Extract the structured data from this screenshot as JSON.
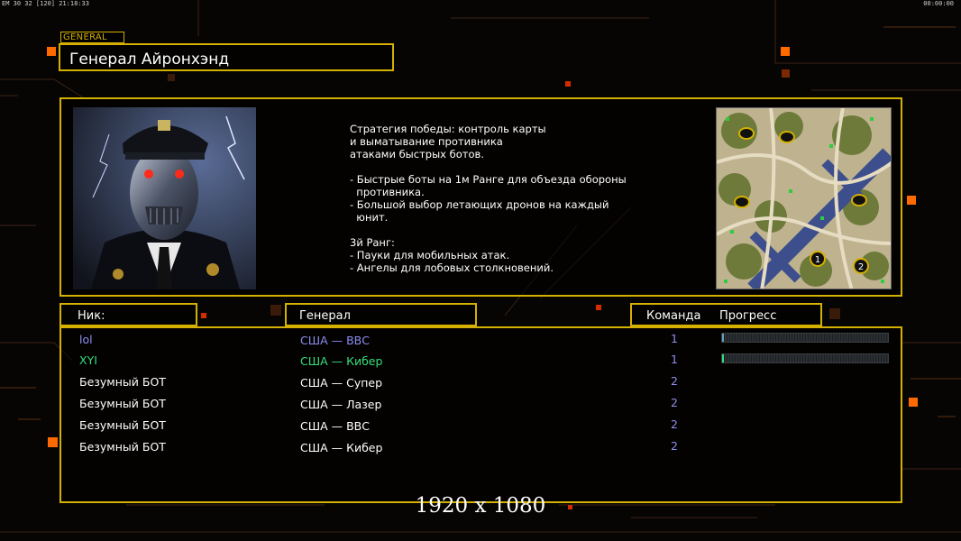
{
  "hud": {
    "left": "EM 30 32 [120] 21:18:33",
    "right": "00:00:00"
  },
  "general_tag": "GENERAL",
  "title": "Генерал Айронхэнд",
  "description": "Стратегия победы: контроль карты\nи выматывание противника\nатаками быстрых ботов.\n\n- Быстрые боты на 1м Ранге для объезда обороны\n  противника.\n- Большой выбор летающих дронов на каждый\n  юнит.\n\n3й Ранг:\n- Пауки для мобильных атак.\n- Ангелы для лобовых столкновений.",
  "headers": {
    "nick": "Ник:",
    "general": "Генерал",
    "team": "Команда",
    "progress": "Прогресс"
  },
  "players": [
    {
      "nick": "lol",
      "general": "США — ВВС",
      "team": "1",
      "color": "#8e8ef2",
      "progress": 0.01
    },
    {
      "nick": "XYI",
      "general": "США — Кибер",
      "team": "1",
      "color": "#34e07a",
      "progress": 0.01
    },
    {
      "nick": "Безумный БОТ",
      "general": "США — Супер",
      "team": "2",
      "color": "#ffffff",
      "progress": null
    },
    {
      "nick": "Безумный БОТ",
      "general": "США — Лазер",
      "team": "2",
      "color": "#ffffff",
      "progress": null
    },
    {
      "nick": "Безумный БОТ",
      "general": "США — ВВС",
      "team": "2",
      "color": "#ffffff",
      "progress": null
    },
    {
      "nick": "Безумный БОТ",
      "general": "США — Кибер",
      "team": "2",
      "color": "#ffffff",
      "progress": null
    }
  ],
  "resolution": "1920 x 1080",
  "colors": {
    "frame": "#d4b000",
    "accent": "#ff6a00",
    "team_text": "#8e8ef2",
    "progress_fill": "#5fa3c7"
  },
  "map_markers": [
    "1",
    "2"
  ]
}
